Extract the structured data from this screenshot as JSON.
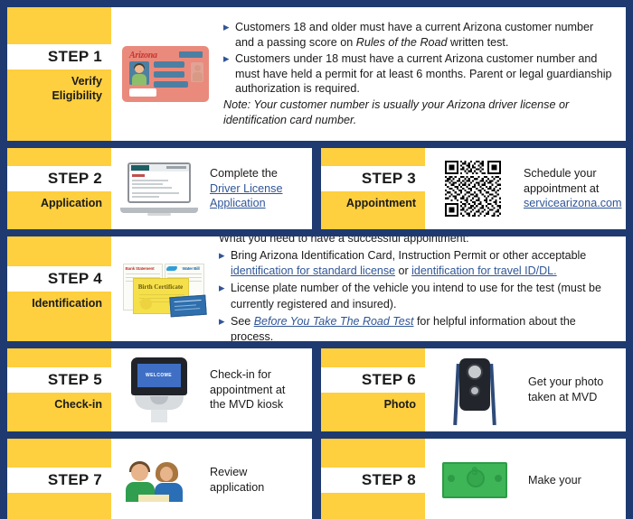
{
  "colors": {
    "navy": "#1e3a70",
    "yellow": "#fecf3e",
    "link": "#2f5597",
    "white": "#ffffff"
  },
  "steps": [
    {
      "id": "step-1",
      "number": "STEP 1",
      "subtitle": "Verify\nEligibility",
      "subtitle_line1": "Verify",
      "subtitle_line2": "Eligibility",
      "icon": "arizona-license-card-icon",
      "icon_text": "Arizona",
      "bullets": [
        {
          "pre": "Customers 18 and older must have a current Arizona customer number and a passing score on ",
          "italic": "Rules of the Road",
          "post": " written test."
        },
        {
          "pre": "Customers under 18 must have a current Arizona customer number and must have held a permit for at least 6 months. Parent or legal guardianship authorization is required.",
          "italic": "",
          "post": ""
        }
      ],
      "note": "Note: Your customer number is usually your Arizona driver license or identification card number."
    },
    {
      "id": "step-2",
      "number": "STEP 2",
      "subtitle_line1": "Application",
      "subtitle_line2": "",
      "icon": "laptop-icon",
      "text_pre": "Complete the",
      "link_text": "Driver License Application",
      "link_line1": "Driver License ",
      "link_line2": "Application"
    },
    {
      "id": "step-3",
      "number": "STEP 3",
      "subtitle_line1": "Appointment",
      "subtitle_line2": "",
      "icon": "qr-code-icon",
      "text_line1": "Schedule your",
      "text_line2": "appointment at",
      "link_text": "servicearizona.com"
    },
    {
      "id": "step-4",
      "number": "STEP 4",
      "subtitle_line1": "Identification",
      "subtitle_line2": "",
      "icon": "documents-icon",
      "doc_labels": {
        "bank": "Bank Statement",
        "water": "Water Bill",
        "cert": "Birth Certificate"
      },
      "lede": "What you need to have a successful appointment:",
      "bullets": [
        {
          "pre": "Bring Arizona Identification Card, Instruction Permit or other acceptable ",
          "link1": "identification for standard license",
          "mid": " or ",
          "link2": "identification for travel ID/DL.",
          "post": ""
        },
        {
          "pre": "License plate number of the vehicle you intend to use for the test (must be currently registered and insured).",
          "link1": "",
          "mid": "",
          "link2": "",
          "post": ""
        },
        {
          "pre": "See ",
          "link1": "Before You Take The Road Test",
          "mid": " for helpful information about the process.",
          "link2": "",
          "post": ""
        }
      ]
    },
    {
      "id": "step-5",
      "number": "STEP 5",
      "subtitle_line1": "Check-in",
      "subtitle_line2": "",
      "icon": "kiosk-icon",
      "icon_text": "WELCOME",
      "text_line1": "Check-in for",
      "text_line2": "appointment at",
      "text_line3": "the MVD kiosk"
    },
    {
      "id": "step-6",
      "number": "STEP 6",
      "subtitle_line1": "Photo",
      "subtitle_line2": "",
      "icon": "camera-tripod-icon",
      "text_line1": "Get your photo",
      "text_line2": "taken at MVD"
    },
    {
      "id": "step-7",
      "number": "STEP 7",
      "subtitle_line1": "",
      "subtitle_line2": "",
      "icon": "two-people-icon",
      "text_line1": "Review",
      "text_line2": "application"
    },
    {
      "id": "step-8",
      "number": "STEP 8",
      "subtitle_line1": "",
      "subtitle_line2": "",
      "icon": "cash-money-icon",
      "text_line1": "Make your",
      "text_line2": ""
    }
  ]
}
